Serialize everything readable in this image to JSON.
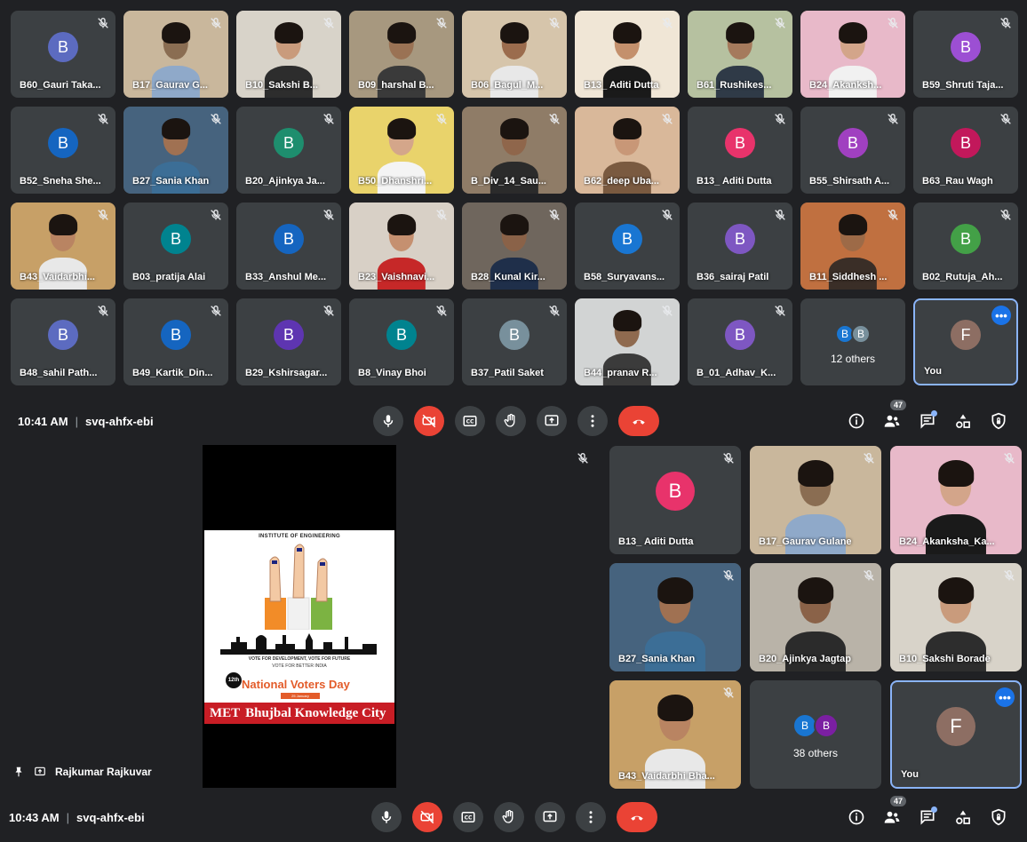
{
  "colors": {
    "meet_bg": "#202124",
    "tile_bg": "#3c4043",
    "danger": "#ea4335",
    "accent": "#1a73e8",
    "self_border": "#8ab4f8"
  },
  "grid1": {
    "tiles": [
      {
        "name": "B60_Gauri Taka...",
        "kind": "avatar",
        "letter": "B",
        "color": "#5c6bc0"
      },
      {
        "name": "B17_Gaurav G...",
        "kind": "cam",
        "tone": "#8a6d52",
        "shirt": "#8fa9c9",
        "bg": "#c9b79c"
      },
      {
        "name": "B10_Sakshi B...",
        "kind": "cam",
        "tone": "#c99b7c",
        "shirt": "#2d2d2d",
        "bg": "#d8d3c9"
      },
      {
        "name": "B09_harshal B...",
        "kind": "cam",
        "tone": "#9a7254",
        "shirt": "#3a3a3a",
        "bg": "#a7987f"
      },
      {
        "name": "B06_Bagul_M...",
        "kind": "cam",
        "tone": "#9b6c4d",
        "shirt": "#e8e8e8",
        "bg": "#d6c5ab"
      },
      {
        "name": "B13_ Aditi Dutta",
        "kind": "cam",
        "tone": "#c4906c",
        "shirt": "#1a1a1a",
        "bg": "#f0e6d6"
      },
      {
        "name": "B61_Rushikes...",
        "kind": "cam",
        "tone": "#a57a5c",
        "shirt": "#2f3a47",
        "bg": "#b6c1a0"
      },
      {
        "name": "B24_Akanksh...",
        "kind": "cam",
        "tone": "#d3a58a",
        "shirt": "#f1f1f1",
        "bg": "#e8b9c9"
      },
      {
        "name": "B59_Shruti Taja...",
        "kind": "avatar",
        "letter": "B",
        "color": "#9c4fd3"
      },
      {
        "name": "B52_Sneha She...",
        "kind": "avatar",
        "letter": "B",
        "color": "#1565c0"
      },
      {
        "name": "B27_Sania Khan",
        "kind": "cam",
        "tone": "#a07152",
        "shirt": "#3c6e96",
        "bg": "#46637e"
      },
      {
        "name": "B20_Ajinkya Ja...",
        "kind": "avatar",
        "letter": "B",
        "color": "#1e8e6e"
      },
      {
        "name": "B50_Dhanshri...",
        "kind": "cam",
        "tone": "#d4a68a",
        "shirt": "#f4f4f4",
        "bg": "#e9d36b"
      },
      {
        "name": "B_Div_14_Sau...",
        "kind": "cam",
        "tone": "#8f664b",
        "shirt": "#2b2b2b",
        "bg": "#8f7c67"
      },
      {
        "name": "B62_deep Uba...",
        "kind": "cam",
        "tone": "#c89777",
        "shirt": "#7a5a40",
        "bg": "#d9b89a"
      },
      {
        "name": "B13_ Aditi Dutta",
        "kind": "avatar",
        "letter": "B",
        "color": "#e8336b"
      },
      {
        "name": "B55_Shirsath A...",
        "kind": "avatar",
        "letter": "B",
        "color": "#a040c0"
      },
      {
        "name": "B63_Rau Wagh",
        "kind": "avatar",
        "letter": "B",
        "color": "#c2185b"
      },
      {
        "name": "B43_Vaidarbhi...",
        "kind": "cam",
        "tone": "#b98462",
        "shirt": "#e8e8e8",
        "bg": "#c7a067"
      },
      {
        "name": "B03_pratija Alai",
        "kind": "avatar",
        "letter": "B",
        "color": "#00838f"
      },
      {
        "name": "B33_Anshul Me...",
        "kind": "avatar",
        "letter": "B",
        "color": "#1565c0"
      },
      {
        "name": "B23_Vaishnavi...",
        "kind": "cam",
        "tone": "#c59070",
        "shirt": "#c62828",
        "bg": "#d8d0c6"
      },
      {
        "name": "B28_Kunal Kir...",
        "kind": "cam",
        "tone": "#8a6248",
        "shirt": "#1f2f4a",
        "bg": "#6f665d"
      },
      {
        "name": "B58_Suryavans...",
        "kind": "avatar",
        "letter": "B",
        "color": "#1976d2"
      },
      {
        "name": "B36_sairaj Patil",
        "kind": "avatar",
        "letter": "B",
        "color": "#7e57c2"
      },
      {
        "name": "B11_Siddhesh ...",
        "kind": "cam",
        "tone": "#9d6a47",
        "shirt": "#3a2e27",
        "bg": "#c07040"
      },
      {
        "name": "B02_Rutuja_Ah...",
        "kind": "avatar",
        "letter": "B",
        "color": "#43a047"
      },
      {
        "name": "B48_sahil Path...",
        "kind": "avatar",
        "letter": "B",
        "color": "#5c6bc0"
      },
      {
        "name": "B49_Kartik_Din...",
        "kind": "avatar",
        "letter": "B",
        "color": "#1565c0"
      },
      {
        "name": "B29_Kshirsagar...",
        "kind": "avatar",
        "letter": "B",
        "color": "#5e35b1"
      },
      {
        "name": "B8_Vinay Bhoi",
        "kind": "avatar",
        "letter": "B",
        "color": "#00838f"
      },
      {
        "name": "B37_Patil Saket",
        "kind": "avatar",
        "letter": "B",
        "color": "#78909c"
      },
      {
        "name": "B44_pranav R...",
        "kind": "cam",
        "tone": "#8f6a4f",
        "shirt": "#3b3b3b",
        "bg": "#d2d4d4"
      },
      {
        "name": "B_01_Adhav_K...",
        "kind": "avatar",
        "letter": "B",
        "color": "#7e57c2"
      },
      {
        "name": "",
        "kind": "others",
        "count_label": "12 others",
        "letters": [
          "B",
          "B"
        ],
        "colors": [
          "#1976d2",
          "#78909c"
        ]
      },
      {
        "name": "You",
        "kind": "self",
        "letter": "F",
        "color": "#8d6e63"
      }
    ]
  },
  "bar1": {
    "time": "10:41 AM",
    "code": "svq-ahfx-ebi",
    "participants": "47"
  },
  "shot2": {
    "presenter": "Rajkumar Rajkuvar",
    "poster": {
      "institute": "INSTITUTE OF ENGINEERING",
      "tagline": "VOTE FOR DEVELOPMENT, VOTE FOR FUTURE",
      "tagline2": "VOTE FOR BETTER INDIA",
      "edition": "12th",
      "title": "National Voters Day",
      "date": "25 January",
      "banner_org": "MET",
      "banner_text": "Bhujbal Knowledge City"
    },
    "tiles": [
      {
        "name": "B13_ Aditi Dutta",
        "kind": "avatar",
        "letter": "B",
        "color": "#e8336b"
      },
      {
        "name": "B17_Gaurav Gulane",
        "kind": "cam",
        "tone": "#8a6d52",
        "shirt": "#8fa9c9",
        "bg": "#c9b79c"
      },
      {
        "name": "B24_Akanksha_Ka...",
        "kind": "cam",
        "tone": "#d3a58a",
        "shirt": "#1a1a1a",
        "bg": "#e8b9c9"
      },
      {
        "name": "B27_Sania Khan",
        "kind": "cam",
        "tone": "#a07152",
        "shirt": "#3c6e96",
        "bg": "#46637e"
      },
      {
        "name": "B20_Ajinkya Jagtap",
        "kind": "cam",
        "tone": "#8a6248",
        "shirt": "#2b2b2b",
        "bg": "#b9b3a8"
      },
      {
        "name": "B10_Sakshi Borade",
        "kind": "cam",
        "tone": "#c99b7c",
        "shirt": "#2d2d2d",
        "bg": "#d8d3c9"
      },
      {
        "name": "B43_Vaidarbhi Bha...",
        "kind": "cam",
        "tone": "#b98462",
        "shirt": "#e8e8e8",
        "bg": "#c7a067"
      },
      {
        "name": "",
        "kind": "others",
        "count_label": "38 others",
        "letters": [
          "B",
          "B"
        ],
        "colors": [
          "#1976d2",
          "#7b1fa2"
        ]
      },
      {
        "name": "You",
        "kind": "self",
        "letter": "F",
        "color": "#8d6e63"
      }
    ]
  },
  "bar2": {
    "time": "10:43 AM",
    "code": "svq-ahfx-ebi",
    "participants": "47"
  },
  "icons": {
    "mic": "mic-icon",
    "cam_off": "camera-off-icon",
    "captions": "captions-icon",
    "hand": "raise-hand-icon",
    "present": "present-icon",
    "more": "more-vert-icon",
    "end": "end-call-icon",
    "info": "info-icon",
    "people": "people-icon",
    "chat": "chat-icon",
    "activities": "activities-icon",
    "host": "host-controls-icon"
  }
}
